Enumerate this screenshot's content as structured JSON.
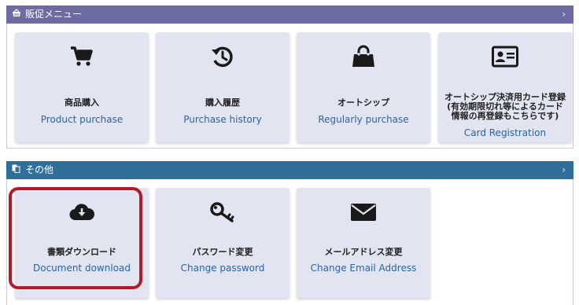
{
  "sections": [
    {
      "title": "販促メニュー",
      "header_color": "#6e6ba3",
      "header_icon": "basket-icon",
      "cards": [
        {
          "jp": "商品購入",
          "en": "Product purchase",
          "icon": "cart-icon"
        },
        {
          "jp": "購入履歴",
          "en": "Purchase history",
          "icon": "history-icon"
        },
        {
          "jp": "オートシップ",
          "en": "Regularly purchase",
          "icon": "shopping-bag-icon"
        },
        {
          "jp_lines": [
            "オートシップ決済用カード登録",
            "(有効期限切れ等によるカード",
            "情報の再登録もこちらです)"
          ],
          "en": "Card Registration",
          "icon": "id-card-icon"
        }
      ]
    },
    {
      "title": "その他",
      "header_color": "#2f6f99",
      "header_icon": "copy-icon",
      "cards": [
        {
          "jp": "書類ダウンロード",
          "en": "Document download",
          "icon": "cloud-download-icon"
        },
        {
          "jp": "パスワード変更",
          "en": "Change password",
          "icon": "key-icon"
        },
        {
          "jp": "メールアドレス変更",
          "en": "Change Email Address",
          "icon": "envelope-icon"
        }
      ]
    }
  ],
  "chevron": "›",
  "highlight_color": "#b51a2b"
}
